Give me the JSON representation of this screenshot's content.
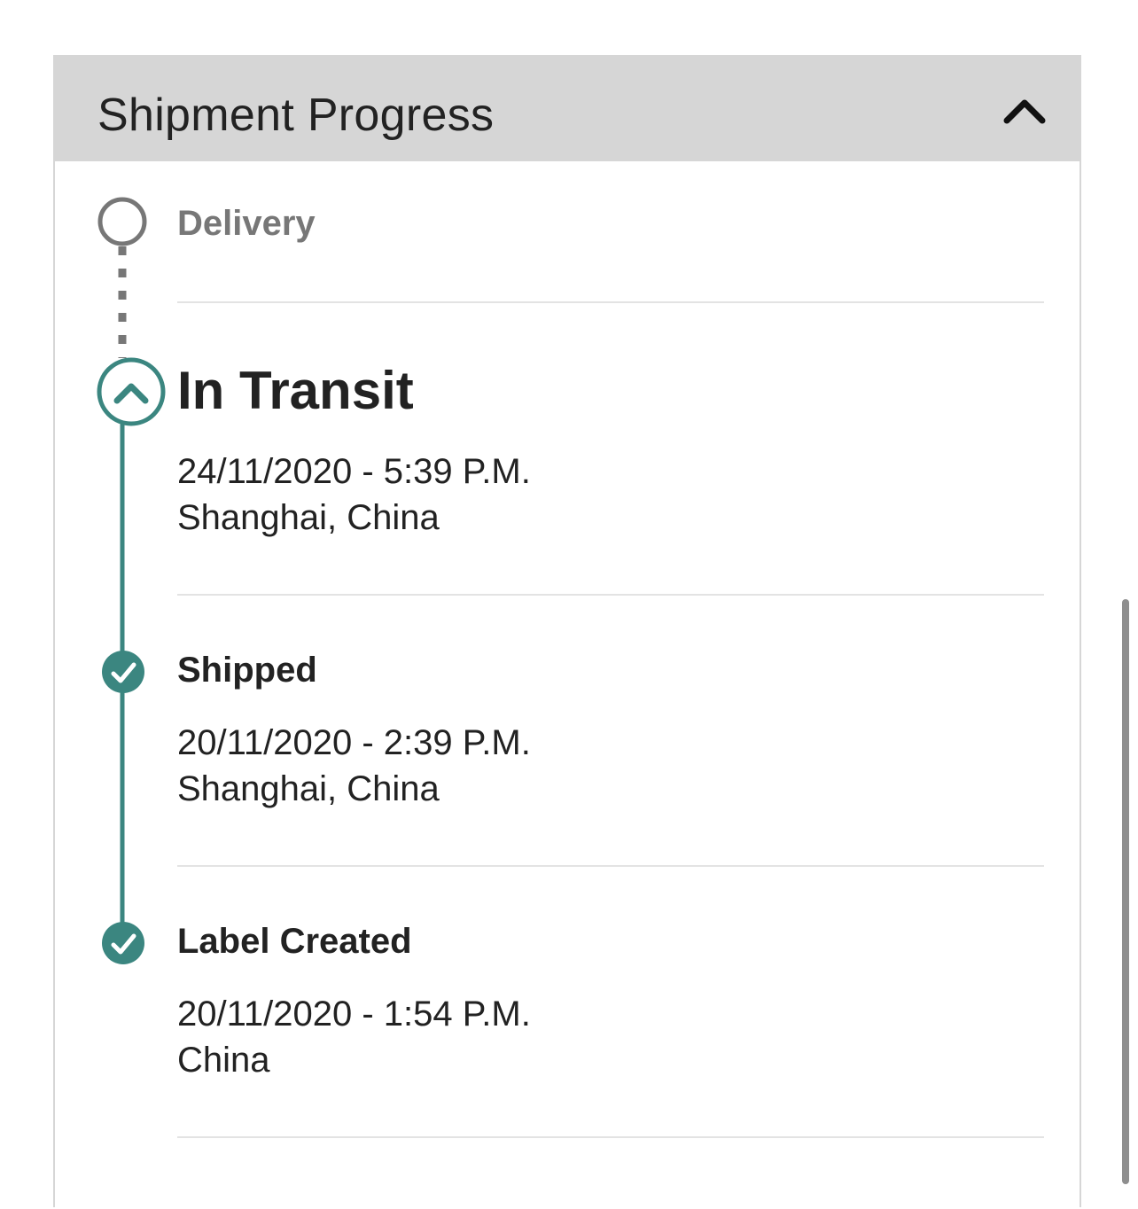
{
  "panel": {
    "title": "Shipment Progress",
    "toggle_icon": "chevron-up-icon"
  },
  "colors": {
    "accent": "#3b8680",
    "pending": "#777777",
    "header_bg": "#d6d6d6"
  },
  "steps": [
    {
      "title": "Delivery",
      "status": "pending",
      "icon": "empty-circle-icon"
    },
    {
      "title": "In Transit",
      "status": "current",
      "icon": "chevron-up-circle-icon",
      "datetime": "24/11/2020 - 5:39 P.M.",
      "location": "Shanghai, China"
    },
    {
      "title": "Shipped",
      "status": "complete",
      "icon": "check-circle-icon",
      "datetime": "20/11/2020 - 2:39 P.M.",
      "location": "Shanghai, China"
    },
    {
      "title": "Label Created",
      "status": "complete",
      "icon": "check-circle-icon",
      "datetime": "20/11/2020 - 1:54 P.M.",
      "location": "China"
    }
  ]
}
